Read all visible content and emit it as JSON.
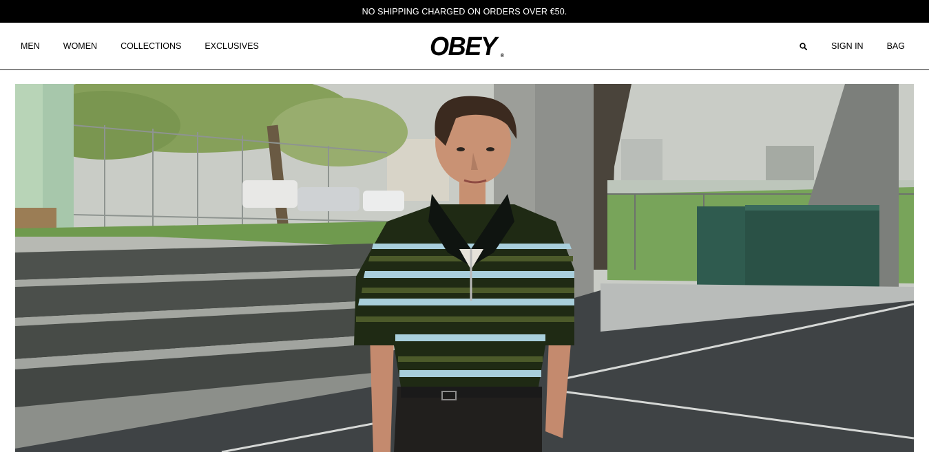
{
  "promo": {
    "text": "NO SHIPPING CHARGED ON ORDERS OVER €50."
  },
  "nav": {
    "left": [
      "MEN",
      "WOMEN",
      "COLLECTIONS",
      "EXCLUSIVES"
    ],
    "right": {
      "search_icon": "search-icon",
      "sign_in": "SIGN IN",
      "bag": "BAG"
    }
  },
  "brand": {
    "logo_text": "OBEY",
    "registered_mark": "®"
  },
  "hero": {
    "image_description_icon": "hero-photo",
    "colors": {
      "shirt_dark": "#1f2a14",
      "shirt_stripe_light": "#a9cfdc",
      "shirt_stripe_olive": "#4c5a2a",
      "court": "#3f4345",
      "steps": "#4b4f4c",
      "grass": "#6f9a4e",
      "bin": "#2f5b4f"
    }
  }
}
